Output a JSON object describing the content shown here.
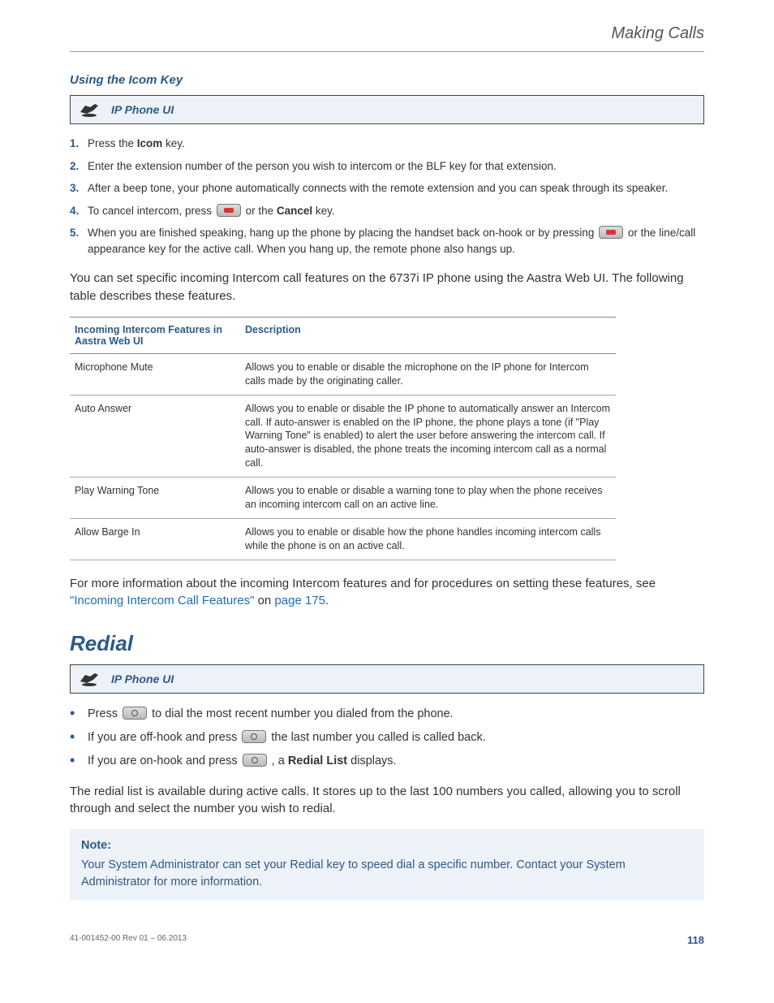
{
  "header": {
    "title": "Making Calls"
  },
  "section1": {
    "heading": "Using the Icom Key",
    "uibox": "IP Phone UI",
    "steps": [
      {
        "n": "1.",
        "pre": "Press the ",
        "b": "Icom",
        "post": " key."
      },
      {
        "n": "2.",
        "text": "Enter the extension number of the person you wish to intercom or the BLF key for that extension."
      },
      {
        "n": "3.",
        "text": "After a beep tone, your phone automatically connects with the remote extension and you can speak through its speaker."
      },
      {
        "n": "4.",
        "pre": "To cancel intercom, press ",
        "icon": "red",
        "mid": " or the ",
        "b": "Cancel",
        "post": " key."
      },
      {
        "n": "5.",
        "pre": "When you are finished speaking, hang up the phone by placing the handset back on-hook or by pressing ",
        "icon": "red",
        "post2": " or the line/call appearance key for the active call. When you hang up, the remote phone also hangs up."
      }
    ],
    "intro": "You can set specific incoming Intercom call features on the 6737i IP phone using the Aastra Web UI. The following table describes these features.",
    "table": {
      "h1": "Incoming Intercom Features in Aastra Web UI",
      "h2": "Description",
      "rows": [
        {
          "f": "Microphone Mute",
          "d": "Allows you to enable or disable the microphone on the IP phone for Intercom calls made by the originating caller."
        },
        {
          "f": "Auto Answer",
          "d": "Allows you to enable or disable the IP phone to automatically answer an Intercom call. If auto-answer is enabled on the IP phone, the phone plays a tone (if \"Play Warning Tone\" is enabled) to alert the user before answering the intercom call. If auto-answer is disabled, the phone treats the incoming intercom call as a normal call."
        },
        {
          "f": "Play Warning Tone",
          "d": "Allows you to enable or disable a warning tone to play when the phone receives an incoming intercom call on an active line."
        },
        {
          "f": "Allow Barge In",
          "d": "Allows you to enable or disable how the phone handles incoming intercom calls while the phone is on an active call."
        }
      ]
    },
    "outro_pre": "For more information about the incoming Intercom features and for procedures on setting these features, see ",
    "outro_link1": "\"Incoming Intercom Call Features\"",
    "outro_mid": " on ",
    "outro_link2": "page 175",
    "outro_post": "."
  },
  "section2": {
    "heading": "Redial",
    "uibox": "IP Phone UI",
    "bullets": [
      {
        "pre": "Press ",
        "icon": "redial",
        "post": " to dial the most recent number you dialed from the phone."
      },
      {
        "pre": "If you are off-hook and press ",
        "icon": "redial",
        "post": " the last number you called is called back."
      },
      {
        "pre": "If you are on-hook and press ",
        "icon": "redial",
        "mid": " , a ",
        "b": "Redial List",
        "post": " displays."
      }
    ],
    "para": "The redial list is available during active calls. It stores up to the last 100 numbers you called, allowing you to scroll through and select the number you wish to redial.",
    "note_label": "Note:",
    "note_text": "Your System Administrator can set your Redial key to speed dial a specific number. Contact your System Administrator for more information."
  },
  "footer": {
    "left": "41-001452-00 Rev 01 – 06.2013",
    "page": "118"
  }
}
